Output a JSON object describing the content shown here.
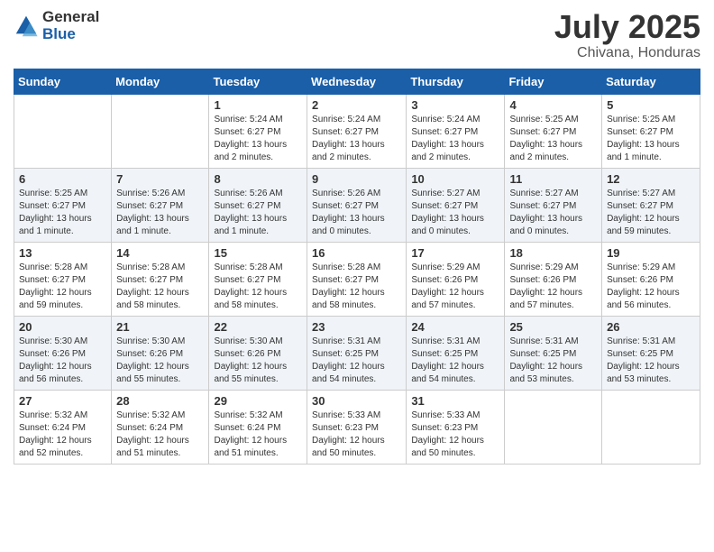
{
  "logo": {
    "general": "General",
    "blue": "Blue"
  },
  "title": {
    "month": "July 2025",
    "location": "Chivana, Honduras"
  },
  "weekdays": [
    "Sunday",
    "Monday",
    "Tuesday",
    "Wednesday",
    "Thursday",
    "Friday",
    "Saturday"
  ],
  "weeks": [
    [
      {
        "day": "",
        "info": ""
      },
      {
        "day": "",
        "info": ""
      },
      {
        "day": "1",
        "info": "Sunrise: 5:24 AM\nSunset: 6:27 PM\nDaylight: 13 hours and 2 minutes."
      },
      {
        "day": "2",
        "info": "Sunrise: 5:24 AM\nSunset: 6:27 PM\nDaylight: 13 hours and 2 minutes."
      },
      {
        "day": "3",
        "info": "Sunrise: 5:24 AM\nSunset: 6:27 PM\nDaylight: 13 hours and 2 minutes."
      },
      {
        "day": "4",
        "info": "Sunrise: 5:25 AM\nSunset: 6:27 PM\nDaylight: 13 hours and 2 minutes."
      },
      {
        "day": "5",
        "info": "Sunrise: 5:25 AM\nSunset: 6:27 PM\nDaylight: 13 hours and 1 minute."
      }
    ],
    [
      {
        "day": "6",
        "info": "Sunrise: 5:25 AM\nSunset: 6:27 PM\nDaylight: 13 hours and 1 minute."
      },
      {
        "day": "7",
        "info": "Sunrise: 5:26 AM\nSunset: 6:27 PM\nDaylight: 13 hours and 1 minute."
      },
      {
        "day": "8",
        "info": "Sunrise: 5:26 AM\nSunset: 6:27 PM\nDaylight: 13 hours and 1 minute."
      },
      {
        "day": "9",
        "info": "Sunrise: 5:26 AM\nSunset: 6:27 PM\nDaylight: 13 hours and 0 minutes."
      },
      {
        "day": "10",
        "info": "Sunrise: 5:27 AM\nSunset: 6:27 PM\nDaylight: 13 hours and 0 minutes."
      },
      {
        "day": "11",
        "info": "Sunrise: 5:27 AM\nSunset: 6:27 PM\nDaylight: 13 hours and 0 minutes."
      },
      {
        "day": "12",
        "info": "Sunrise: 5:27 AM\nSunset: 6:27 PM\nDaylight: 12 hours and 59 minutes."
      }
    ],
    [
      {
        "day": "13",
        "info": "Sunrise: 5:28 AM\nSunset: 6:27 PM\nDaylight: 12 hours and 59 minutes."
      },
      {
        "day": "14",
        "info": "Sunrise: 5:28 AM\nSunset: 6:27 PM\nDaylight: 12 hours and 58 minutes."
      },
      {
        "day": "15",
        "info": "Sunrise: 5:28 AM\nSunset: 6:27 PM\nDaylight: 12 hours and 58 minutes."
      },
      {
        "day": "16",
        "info": "Sunrise: 5:28 AM\nSunset: 6:27 PM\nDaylight: 12 hours and 58 minutes."
      },
      {
        "day": "17",
        "info": "Sunrise: 5:29 AM\nSunset: 6:26 PM\nDaylight: 12 hours and 57 minutes."
      },
      {
        "day": "18",
        "info": "Sunrise: 5:29 AM\nSunset: 6:26 PM\nDaylight: 12 hours and 57 minutes."
      },
      {
        "day": "19",
        "info": "Sunrise: 5:29 AM\nSunset: 6:26 PM\nDaylight: 12 hours and 56 minutes."
      }
    ],
    [
      {
        "day": "20",
        "info": "Sunrise: 5:30 AM\nSunset: 6:26 PM\nDaylight: 12 hours and 56 minutes."
      },
      {
        "day": "21",
        "info": "Sunrise: 5:30 AM\nSunset: 6:26 PM\nDaylight: 12 hours and 55 minutes."
      },
      {
        "day": "22",
        "info": "Sunrise: 5:30 AM\nSunset: 6:26 PM\nDaylight: 12 hours and 55 minutes."
      },
      {
        "day": "23",
        "info": "Sunrise: 5:31 AM\nSunset: 6:25 PM\nDaylight: 12 hours and 54 minutes."
      },
      {
        "day": "24",
        "info": "Sunrise: 5:31 AM\nSunset: 6:25 PM\nDaylight: 12 hours and 54 minutes."
      },
      {
        "day": "25",
        "info": "Sunrise: 5:31 AM\nSunset: 6:25 PM\nDaylight: 12 hours and 53 minutes."
      },
      {
        "day": "26",
        "info": "Sunrise: 5:31 AM\nSunset: 6:25 PM\nDaylight: 12 hours and 53 minutes."
      }
    ],
    [
      {
        "day": "27",
        "info": "Sunrise: 5:32 AM\nSunset: 6:24 PM\nDaylight: 12 hours and 52 minutes."
      },
      {
        "day": "28",
        "info": "Sunrise: 5:32 AM\nSunset: 6:24 PM\nDaylight: 12 hours and 51 minutes."
      },
      {
        "day": "29",
        "info": "Sunrise: 5:32 AM\nSunset: 6:24 PM\nDaylight: 12 hours and 51 minutes."
      },
      {
        "day": "30",
        "info": "Sunrise: 5:33 AM\nSunset: 6:23 PM\nDaylight: 12 hours and 50 minutes."
      },
      {
        "day": "31",
        "info": "Sunrise: 5:33 AM\nSunset: 6:23 PM\nDaylight: 12 hours and 50 minutes."
      },
      {
        "day": "",
        "info": ""
      },
      {
        "day": "",
        "info": ""
      }
    ]
  ]
}
